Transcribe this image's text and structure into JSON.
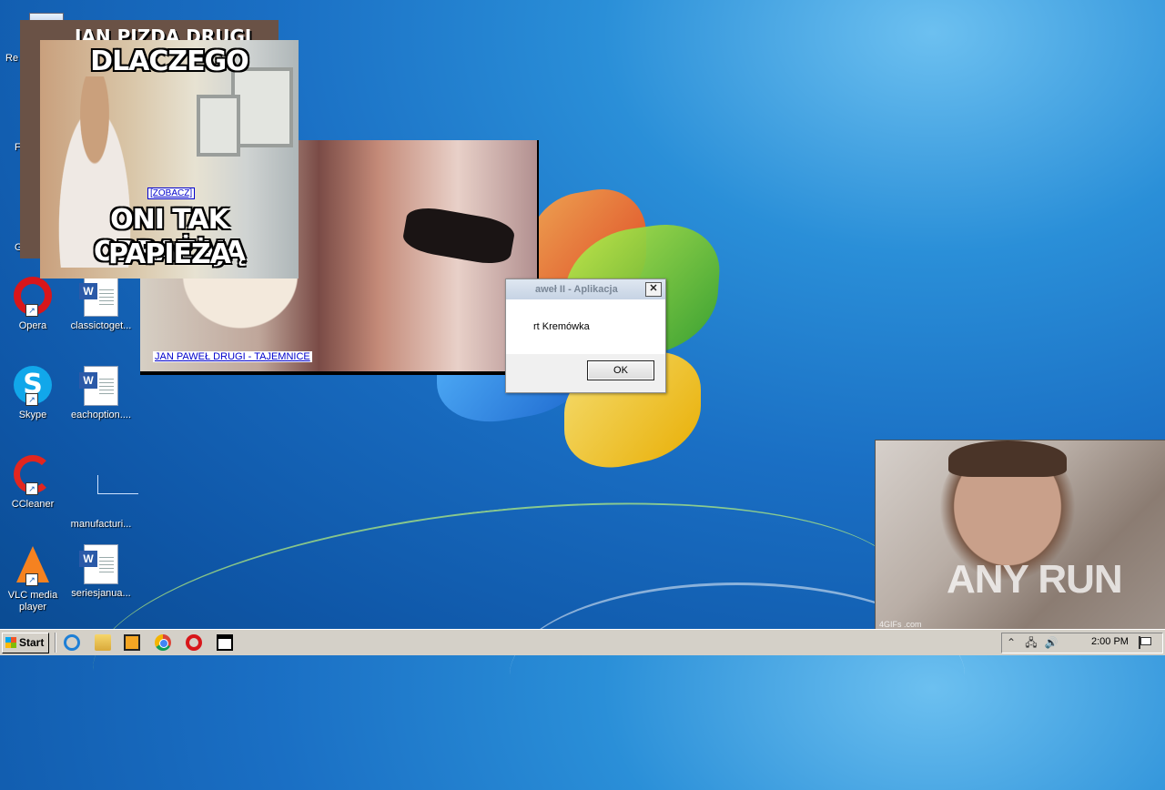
{
  "desktop": {
    "icons": [
      {
        "label": "Re",
        "kind": "recycle-bin"
      },
      {
        "label": "F",
        "kind": "app"
      },
      {
        "label": "G",
        "kind": "app"
      },
      {
        "label": "Opera",
        "kind": "opera"
      },
      {
        "label": "classictoget...",
        "kind": "word-doc"
      },
      {
        "label": "Skype",
        "kind": "skype"
      },
      {
        "label": "eachoption....",
        "kind": "word-doc"
      },
      {
        "label": "CCleaner",
        "kind": "ccleaner"
      },
      {
        "label": "manufacturi...",
        "kind": "blank-file"
      },
      {
        "label": "VLC media player",
        "kind": "vlc"
      },
      {
        "label": "seriesjanua...",
        "kind": "word-doc"
      }
    ]
  },
  "meme_back": {
    "caption": "JAN PIZDA DRUGI"
  },
  "meme_front": {
    "caption_top": "DLACZEGO",
    "caption_mid": "ONI TAK OBRAŻAJĄ",
    "caption_bottom": "PAPIEŻA",
    "link": "[ZOBACZ]"
  },
  "video": {
    "link": "JAN PAWEŁ DRUGI - TAJEMNICE"
  },
  "gif": {
    "watermark": "4GIFs .com",
    "overlay": "ANY RUN"
  },
  "dialog": {
    "title": "aweł II - Aplikacja",
    "close": "✕",
    "message": "rt Kremówka",
    "ok": "OK"
  },
  "taskbar": {
    "start": "Start",
    "quicklaunch": [
      "internet-explorer-icon",
      "folder-icon",
      "media-player-icon",
      "chrome-icon",
      "opera-icon",
      "window-icon"
    ],
    "tray": {
      "clock": "2:00 PM",
      "show_hidden": "⌃",
      "network": "🖧",
      "volume": "🔊"
    }
  }
}
